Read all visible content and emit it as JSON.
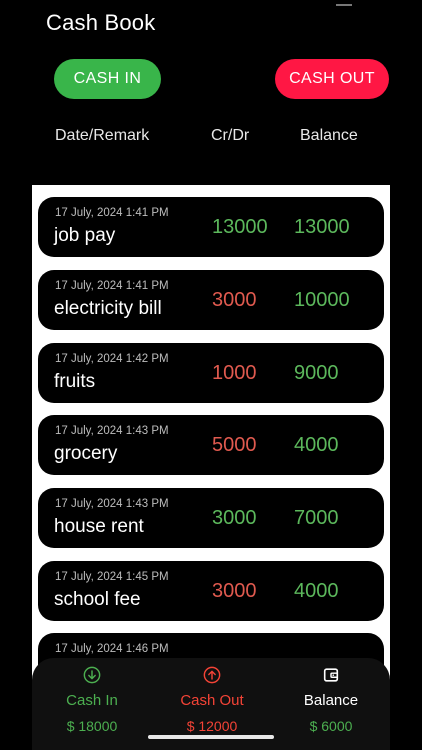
{
  "header": {
    "title": "Cash Book"
  },
  "actions": {
    "cash_in_label": "CASH IN",
    "cash_out_label": "CASH OUT"
  },
  "columns": {
    "date_remark": "Date/Remark",
    "cr_dr": "Cr/Dr",
    "balance": "Balance"
  },
  "entries": [
    {
      "date": "17 July, 2024 1:41 PM",
      "remark": "job pay",
      "amount": "13000",
      "type": "credit",
      "balance": "13000"
    },
    {
      "date": "17 July, 2024 1:41 PM",
      "remark": "electricity bill",
      "amount": "3000",
      "type": "debit",
      "balance": "10000"
    },
    {
      "date": "17 July, 2024 1:42 PM",
      "remark": "fruits",
      "amount": "1000",
      "type": "debit",
      "balance": "9000"
    },
    {
      "date": "17 July, 2024 1:43 PM",
      "remark": "grocery",
      "amount": "5000",
      "type": "debit",
      "balance": "4000"
    },
    {
      "date": "17 July, 2024 1:43 PM",
      "remark": "house rent",
      "amount": "3000",
      "type": "credit",
      "balance": "7000"
    },
    {
      "date": "17 July, 2024 1:45 PM",
      "remark": "school fee",
      "amount": "3000",
      "type": "debit",
      "balance": "4000"
    },
    {
      "date": "17 July, 2024 1:46 PM",
      "remark": "",
      "amount": "",
      "type": "credit",
      "balance": ""
    }
  ],
  "summary": {
    "cash_in": {
      "label": "Cash In",
      "value": "$ 18000",
      "icon": "arrow-down-circle-icon"
    },
    "cash_out": {
      "label": "Cash Out",
      "value": "$ 12000",
      "icon": "arrow-up-circle-icon"
    },
    "balance": {
      "label": "Balance",
      "value": "$ 6000",
      "icon": "wallet-icon"
    }
  },
  "colors": {
    "green": "#39b54a",
    "red": "#ff1744",
    "credit": "#5cb85c",
    "debit": "#e05a4f"
  }
}
